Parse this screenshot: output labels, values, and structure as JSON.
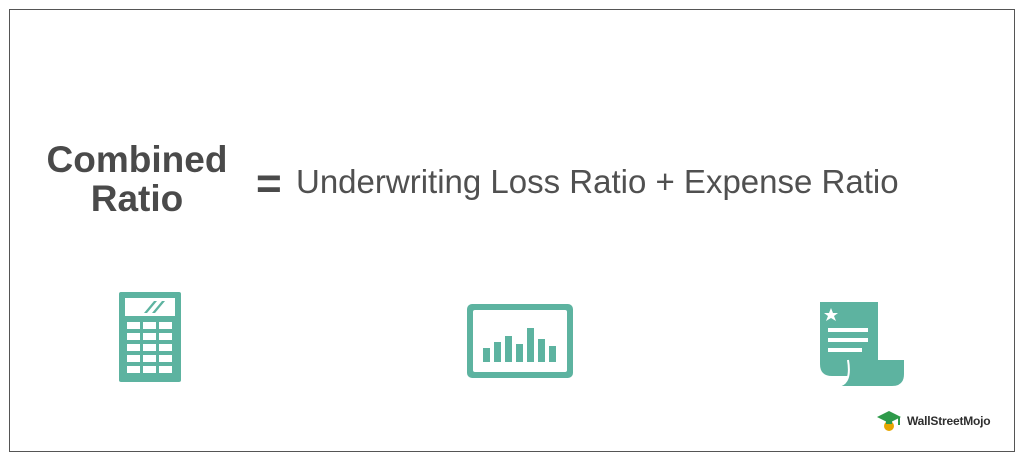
{
  "formula": {
    "lhs_line1": "Combined",
    "lhs_line2": "Ratio",
    "equals": "=",
    "rhs": "Underwriting Loss Ratio + Expense Ratio"
  },
  "icons": [
    "calculator-icon",
    "bar-chart-icon",
    "document-icon"
  ],
  "logo": {
    "text": "WallStreetMojo"
  },
  "colors": {
    "icon_teal": "#5db3a0",
    "text_dark": "#4a4a4a",
    "border": "#555555",
    "logo_green": "#2e9a4a",
    "logo_gold": "#e6a600"
  }
}
